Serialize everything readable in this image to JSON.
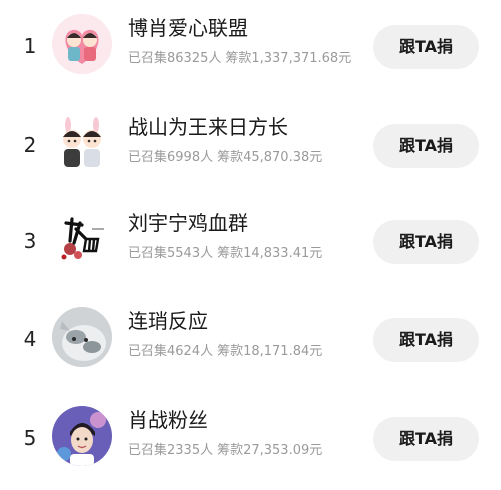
{
  "groups": [
    {
      "rank": "1",
      "name": "博肖爱心联盟",
      "collected": "已召集86325人",
      "raised": "筹款1,337,371.68元",
      "button_label": "跟TA捐",
      "avatar_icon": "couple-cartoon-heart-icon"
    },
    {
      "rank": "2",
      "name": "战山为王来日方长",
      "collected": "已召集6998人",
      "raised": "筹款45,870.38元",
      "button_label": "跟TA捐",
      "avatar_icon": "couple-cartoon-bunny-icon"
    },
    {
      "rank": "3",
      "name": "刘宇宁鸡血群",
      "collected": "已召集5543人",
      "raised": "筹款14,833.41元",
      "button_label": "跟TA捐",
      "avatar_icon": "calligraphy-logo-icon"
    },
    {
      "rank": "4",
      "name": "连琑反应",
      "collected": "已召集4624人",
      "raised": "筹款18,171.84元",
      "button_label": "跟TA捐",
      "avatar_icon": "cat-photo-icon"
    },
    {
      "rank": "5",
      "name": "肖战粉丝",
      "collected": "已召集2335人",
      "raised": "筹款27,353.09元",
      "button_label": "跟TA捐",
      "avatar_icon": "person-portrait-icon"
    }
  ]
}
